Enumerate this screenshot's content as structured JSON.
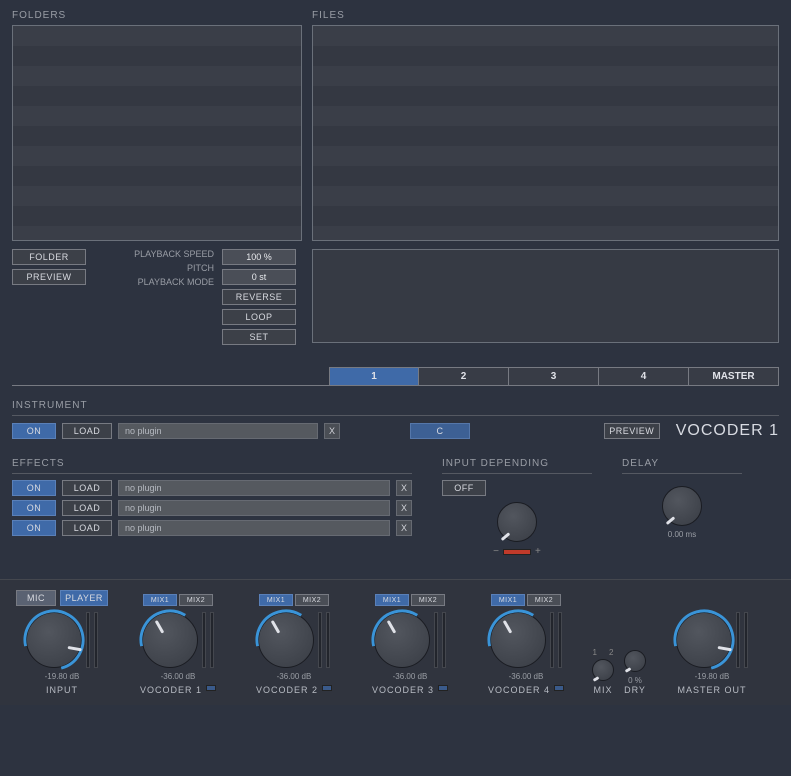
{
  "browser": {
    "folders_label": "FOLDERS",
    "files_label": "FILES",
    "folder_btn": "FOLDER",
    "preview_btn": "PREVIEW"
  },
  "playback": {
    "speed_label": "PLAYBACK SPEED",
    "speed_val": "100 %",
    "pitch_label": "PITCH",
    "pitch_val": "0 st",
    "mode_label": "PLAYBACK  MODE",
    "reverse_btn": "REVERSE",
    "loop_btn": "LOOP",
    "set_btn": "SET"
  },
  "tabs": {
    "t1": "1",
    "t2": "2",
    "t3": "3",
    "t4": "4",
    "master": "MASTER"
  },
  "instrument": {
    "label": "INSTRUMENT",
    "on": "ON",
    "load": "LOAD",
    "no_plugin": "no plugin",
    "x": "X",
    "note": "C",
    "preview": "PREVIEW",
    "title": "VOCODER 1"
  },
  "effects": {
    "label": "EFFECTS",
    "on": "ON",
    "load": "LOAD",
    "no_plugin": "no plugin",
    "x": "X"
  },
  "input_depending": {
    "label": "INPUT DEPENDING",
    "off": "OFF",
    "minus": "−",
    "plus": "+"
  },
  "delay": {
    "label": "DELAY",
    "value": "0.00 ms"
  },
  "footer": {
    "mic": "MIC",
    "player": "PLAYER",
    "mix1": "MIX1",
    "mix2": "MIX2",
    "input_label": "INPUT",
    "input_db": "-19.80 dB",
    "voc1": "VOCODER 1",
    "voc1_db": "-36.00 dB",
    "voc2": "VOCODER 2",
    "voc2_db": "-36.00 dB",
    "voc3": "VOCODER 3",
    "voc3_db": "-36.00 dB",
    "voc4": "VOCODER 4",
    "voc4_db": "-36.00 dB",
    "mix_1": "1",
    "mix_2": "2",
    "mix_label": "MIX",
    "dry_pct": "0 %",
    "dry_label": "DRY",
    "master_db": "-19.80 dB",
    "master_label": "MASTER OUT"
  }
}
